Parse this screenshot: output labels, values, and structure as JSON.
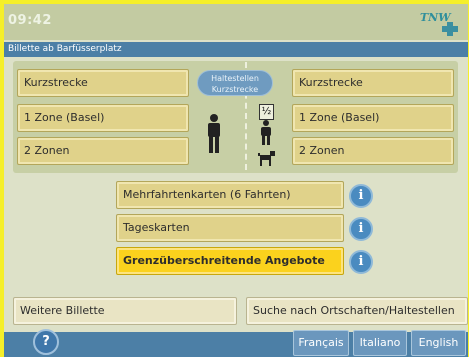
{
  "header": {
    "time": "09:42",
    "logo_text": "TNW"
  },
  "titlebar": {
    "title": "Billette ab Barfüsserplatz"
  },
  "left_column": [
    {
      "label": "Kurzstrecke"
    },
    {
      "label": "1 Zone (Basel)"
    },
    {
      "label": "2 Zonen"
    }
  ],
  "center_pill": {
    "line1": "Haltestellen",
    "line2": "Kurzstrecke"
  },
  "right_column": [
    {
      "label": "Kurzstrecke"
    },
    {
      "label": "1 Zone (Basel)"
    },
    {
      "label": "2 Zonen"
    }
  ],
  "half_fare_label": "½",
  "middle_options": [
    {
      "label": "Mehrfahrtenkarten (6 Fahrten)",
      "selected": false
    },
    {
      "label": "Tageskarten",
      "selected": false
    },
    {
      "label": "Grenzüberschreitende Angebote",
      "selected": true
    }
  ],
  "info_glyph": "i",
  "bottom_buttons": {
    "further_tickets": "Weitere Billette",
    "search_places": "Suche nach Ortschaften/Haltestellen"
  },
  "footer": {
    "help_glyph": "?",
    "languages": [
      "Français",
      "Italiano",
      "English"
    ]
  },
  "colors": {
    "frame": "#f5ef2a",
    "bar_blue": "#4c7fa6",
    "button": "#e0d28a",
    "selected_button": "#fbd21d",
    "info_blue": "#4a8bc0"
  }
}
